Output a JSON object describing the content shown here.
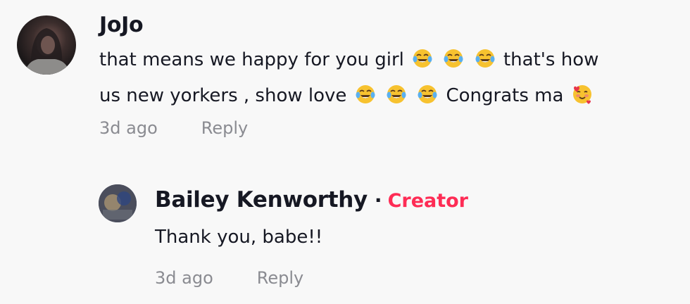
{
  "comments": [
    {
      "username": "JoJo",
      "text_line1_a": "that means we happy for you girl",
      "text_line1_b": "that's how",
      "text_line2_a": "us new yorkers , show love",
      "text_line2_b": "Congrats ma",
      "emoji_laugh": "😂",
      "emoji_love": "🥰",
      "time": "3d ago",
      "reply_label": "Reply"
    }
  ],
  "reply": {
    "username": "Bailey Kenworthy",
    "separator": "·",
    "badge": "Creator",
    "text": "Thank you, babe!!",
    "time": "3d ago",
    "reply_label": "Reply"
  },
  "colors": {
    "background": "#f8f8f8",
    "text": "#161823",
    "meta": "#8a8b91",
    "creator_badge": "#fe2c55"
  },
  "icons": {
    "laugh_emoji": "face-with-tears-of-joy-icon",
    "love_emoji": "smiling-face-with-hearts-icon"
  }
}
